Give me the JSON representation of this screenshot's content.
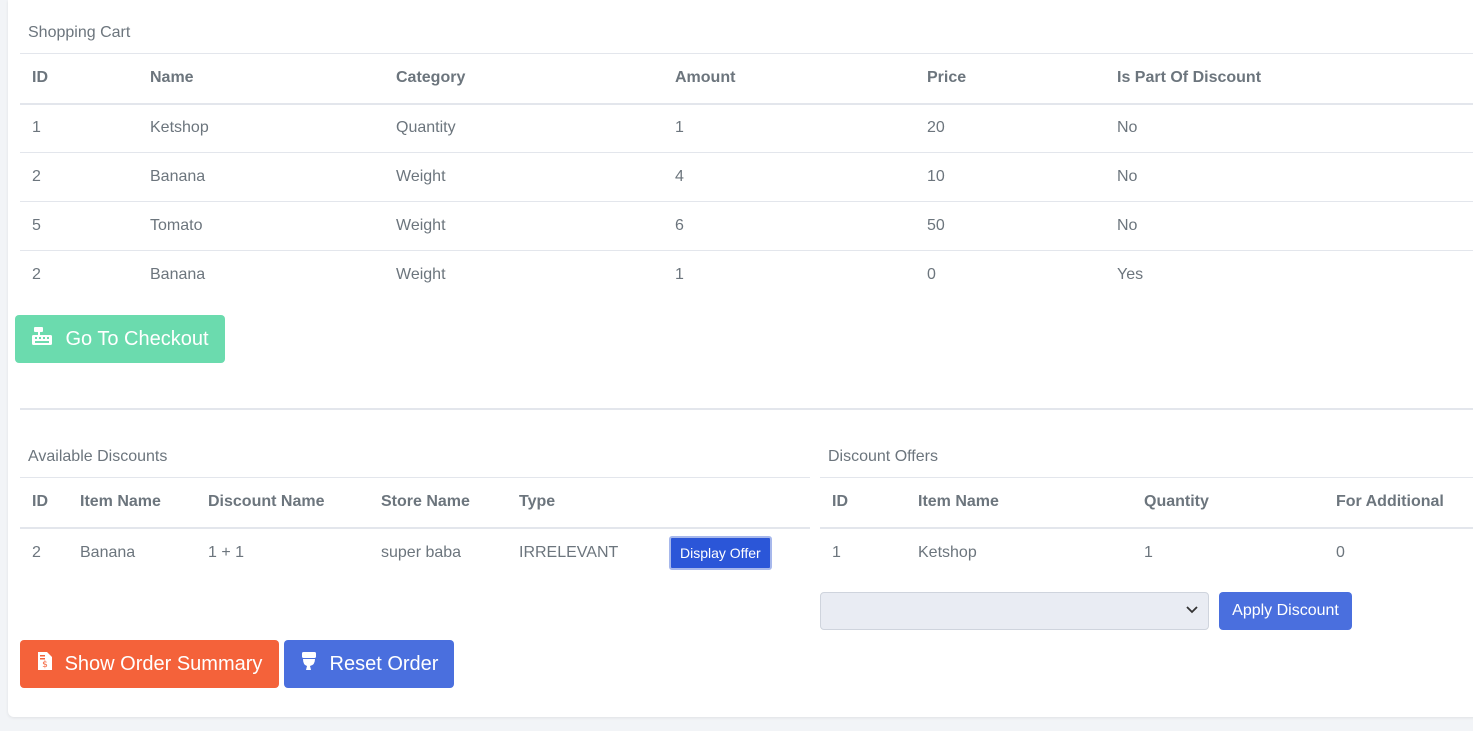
{
  "cart": {
    "title": "Shopping Cart",
    "columns": [
      "ID",
      "Name",
      "Category",
      "Amount",
      "Price",
      "Is Part Of Discount"
    ],
    "rows": [
      [
        "1",
        "Ketshop",
        "Quantity",
        "1",
        "20",
        "No"
      ],
      [
        "2",
        "Banana",
        "Weight",
        "4",
        "10",
        "No"
      ],
      [
        "5",
        "Tomato",
        "Weight",
        "6",
        "50",
        "No"
      ],
      [
        "2",
        "Banana",
        "Weight",
        "1",
        "0",
        "Yes"
      ]
    ],
    "checkout_label": "Go To Checkout",
    "checkout_icon": "cash-register-icon"
  },
  "discounts": {
    "title": "Available Discounts",
    "columns": [
      "ID",
      "Item Name",
      "Discount Name",
      "Store Name",
      "Type",
      ""
    ],
    "rows": [
      [
        "2",
        "Banana",
        "1 + 1",
        "super baba",
        "IRRELEVANT"
      ]
    ],
    "display_offer_label": "Display Offer"
  },
  "offers": {
    "title": "Discount Offers",
    "columns": [
      "ID",
      "Item Name",
      "Quantity",
      "For Additional"
    ],
    "rows": [
      [
        "1",
        "Ketshop",
        "1",
        "0"
      ]
    ],
    "select_value": "",
    "apply_label": "Apply Discount"
  },
  "actions": {
    "summary_label": "Show Order Summary",
    "summary_icon": "invoice-icon",
    "reset_label": "Reset Order",
    "reset_icon": "toilet-icon"
  },
  "colors": {
    "checkout": "#6bdbae",
    "summary": "#f4623a",
    "reset": "#4a6fde",
    "display_offer": "#2b56d8"
  }
}
